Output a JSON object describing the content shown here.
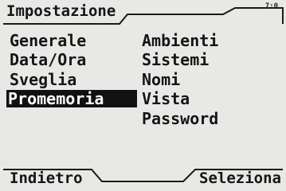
{
  "header": {
    "title": "Impostazione",
    "clock": "7:0"
  },
  "menu": {
    "left_column": [
      {
        "label": "Generale",
        "selected": false
      },
      {
        "label": "Data/Ora",
        "selected": false
      },
      {
        "label": "Sveglia",
        "selected": false
      },
      {
        "label": "Promemoria",
        "selected": true
      }
    ],
    "right_column": [
      {
        "label": "Ambienti",
        "selected": false
      },
      {
        "label": "Sistemi",
        "selected": false
      },
      {
        "label": "Nomi",
        "selected": false
      },
      {
        "label": "Vista",
        "selected": false
      },
      {
        "label": "Password",
        "selected": false
      }
    ]
  },
  "softkeys": {
    "left_label": "Indietro",
    "right_label": "Seleziona"
  }
}
